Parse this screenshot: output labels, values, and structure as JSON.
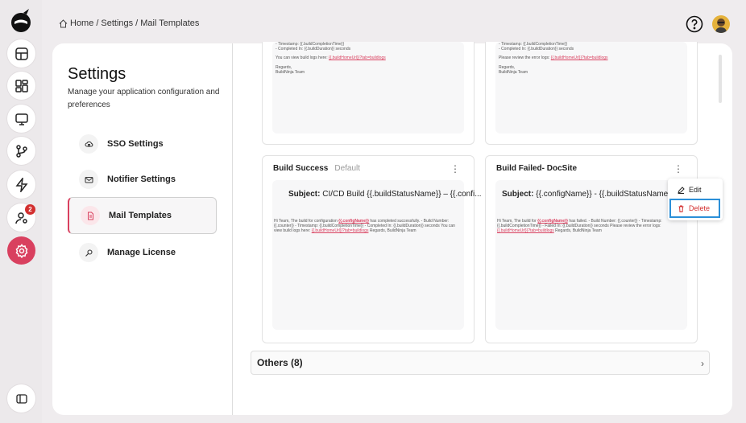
{
  "breadcrumb": {
    "home": "Home",
    "sep1": "/",
    "settings": "Settings",
    "sep2": "/",
    "current": "Mail Templates"
  },
  "sidebar_rail": {
    "badge_count": "2",
    "active_item": "settings-icon"
  },
  "settings": {
    "title": "Settings",
    "description": "Manage your application configuration and preferences",
    "nav": [
      {
        "label": "SSO Settings",
        "icon": "cloud-lock-icon"
      },
      {
        "label": "Notifier Settings",
        "icon": "mail-icon"
      },
      {
        "label": "Mail Templates",
        "icon": "document-icon"
      },
      {
        "label": "Manage License",
        "icon": "key-icon"
      }
    ]
  },
  "top_cards": {
    "left": {
      "line1": "- Timestamp: {{.buildCompletionTime}}",
      "line2": "- Completed In: {{.buildDuration}} seconds",
      "logs_text": "You can view build logs here:",
      "logs_link": "{{.buildHomeUrl}}?tab=buildlogs",
      "regards": "Regards,",
      "team": "BuildNinja Team"
    },
    "right": {
      "line1": "- Timestamp: {{.buildCompletionTime}}",
      "line2": "- Completed In: {{.buildDuration}} seconds",
      "logs_text": "Please review the error logs:",
      "logs_link": "{{.buildHomeUrl}}?tab=buildlogs",
      "regards": "Regards,",
      "team": "BuildNinja Team"
    }
  },
  "cards": [
    {
      "title": "Build Success",
      "tag": "Default",
      "subject_label": "Subject:",
      "subject": "CI/CD Build {{.buildStatusName}} – {{.confi...",
      "body_pre": "Hi Team, The build for configuration",
      "body_var": "{{.configName}}",
      "body_mid": "has completed successfully. - Build Number: {{.counter}} - Timestamp: {{.buildCompletionTime}} - Completed In: {{.buildDuration}} seconds You can view build logs here:",
      "body_link": "{{.buildHomeUrl}}?tab=buildlogs",
      "body_end": "Regards, BuildNinja Team"
    },
    {
      "title": "Build Failed- DocSite",
      "tag": "",
      "subject_label": "Subject:",
      "subject": "{{.configName}} - {{.buildStatusName(str",
      "body_pre": "Hi Team, The build for",
      "body_var": "{{.configName}}",
      "body_mid": "has failed. - Build Number: {{.counter}} - Timestamp: {{.buildCompletionTime}} - Failed In: {{.buildDuration}} seconds Please review the error logs:",
      "body_link": "{{.buildHomeUrl}}?tab=buildlogs",
      "body_end": "Regards, BuildNinja Team"
    }
  ],
  "context_menu": {
    "edit": "Edit",
    "delete": "Delete"
  },
  "others": {
    "label": "Others (8)"
  },
  "colors": {
    "accent": "#d9405f",
    "focus": "#2b8fd8"
  }
}
